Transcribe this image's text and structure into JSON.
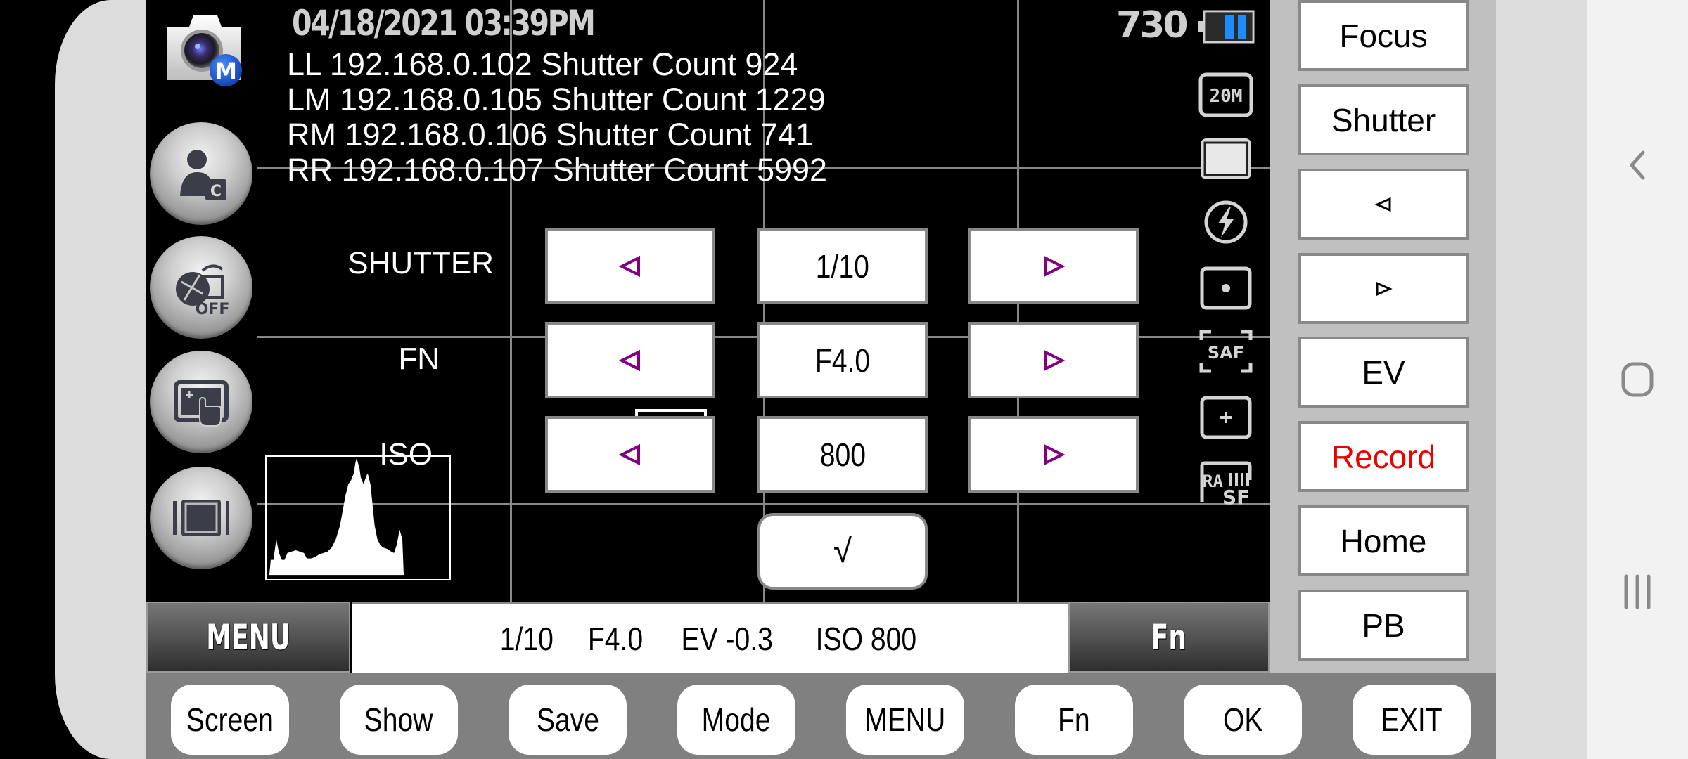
{
  "header": {
    "datetime": "04/18/2021 03:39PM",
    "shots_remaining": "730",
    "battery_level": "partial",
    "camera_mode_badge": "M"
  },
  "cameras": [
    {
      "text": "LL 192.168.0.102 Shutter Count 924"
    },
    {
      "text": "LM 192.168.0.105 Shutter Count 1229"
    },
    {
      "text": "RM 192.168.0.106 Shutter Count 741"
    },
    {
      "text": "RR 192.168.0.107 Shutter Count 5992"
    }
  ],
  "left_buttons": [
    {
      "icon": "custom-mode-icon"
    },
    {
      "icon": "anti-shock-off-icon"
    },
    {
      "icon": "touch-shutter-icon"
    },
    {
      "icon": "live-view-frame-icon"
    }
  ],
  "controls": {
    "rows": [
      {
        "label": "SHUTTER",
        "value": "1/10",
        "dec": "◁",
        "inc": "▷"
      },
      {
        "label": "FN",
        "value": "F4.0",
        "dec": "◁",
        "inc": "▷"
      },
      {
        "label": "ISO",
        "value": "800",
        "dec": "◁",
        "inc": "▷"
      }
    ],
    "confirm": "√",
    "arrow_color": "#800080"
  },
  "status_icons": [
    {
      "name": "image-size-20m-icon",
      "text": "20M"
    },
    {
      "name": "aspect-ratio-icon"
    },
    {
      "name": "flash-off-icon"
    },
    {
      "name": "spot-metering-icon"
    },
    {
      "name": "saf-focus-icon",
      "text": "SAF"
    },
    {
      "name": "af-target-icon"
    },
    {
      "name": "raw-sf-quality-icon",
      "text": "RAW SF"
    }
  ],
  "info_bar": {
    "menu_label": "MENU",
    "shutter": "1/10",
    "aperture": "F4.0",
    "ev": "EV -0.3",
    "iso": "ISO 800",
    "fn_label": "Fn"
  },
  "side_buttons": [
    {
      "label": "Focus"
    },
    {
      "label": "Shutter"
    },
    {
      "label": "◁"
    },
    {
      "label": "▷"
    },
    {
      "label": "EV"
    },
    {
      "label": "Record",
      "color": "#ee0000"
    },
    {
      "label": "Home"
    },
    {
      "label": "PB"
    }
  ],
  "bottom_buttons": [
    {
      "label": "Screen"
    },
    {
      "label": "Show"
    },
    {
      "label": "Save"
    },
    {
      "label": "Mode"
    },
    {
      "label": "MENU"
    },
    {
      "label": "Fn"
    },
    {
      "label": "OK"
    },
    {
      "label": "EXIT"
    }
  ],
  "system_nav": [
    {
      "name": "back"
    },
    {
      "name": "home"
    },
    {
      "name": "recents"
    }
  ]
}
